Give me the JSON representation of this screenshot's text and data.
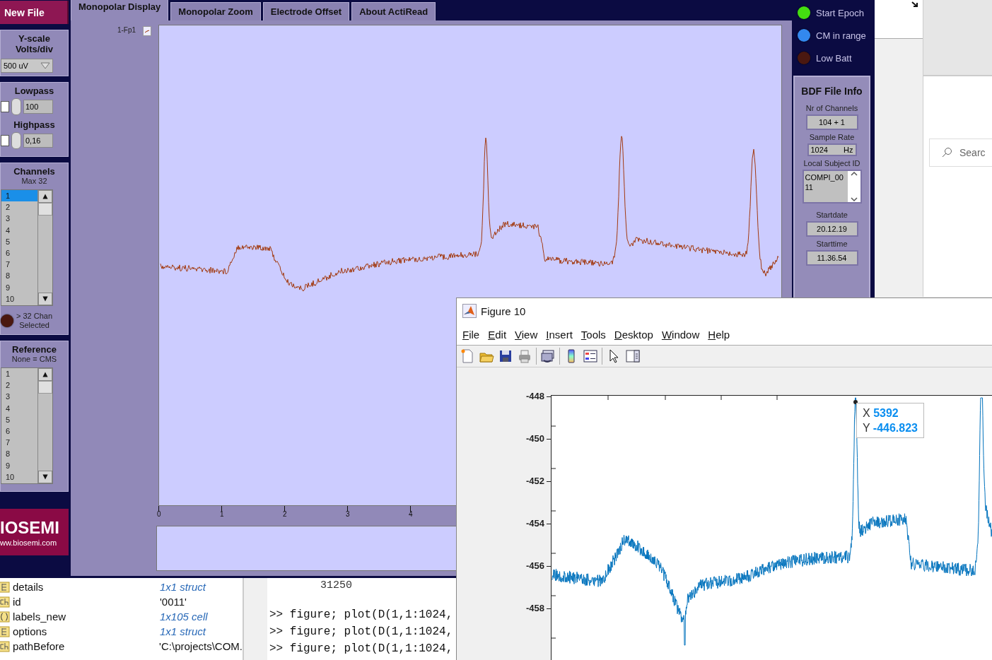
{
  "actiread": {
    "new_file_button": "New File",
    "yscale": {
      "title": "Y-scale",
      "subtitle": "Volts/div",
      "value": "500 uV"
    },
    "filters": [
      {
        "label": "Lowpass",
        "checked": false,
        "value": "100"
      },
      {
        "label": "Highpass",
        "checked": false,
        "value": "0,16"
      }
    ],
    "channels": {
      "title": "Channels",
      "subtitle": "Max 32",
      "items": [
        {
          "label": "1",
          "selected": true
        },
        {
          "label": "2",
          "selected": false
        },
        {
          "label": "3",
          "selected": false
        },
        {
          "label": "4",
          "selected": false
        },
        {
          "label": "5",
          "selected": false
        },
        {
          "label": "6",
          "selected": false
        },
        {
          "label": "7",
          "selected": false
        },
        {
          "label": "8",
          "selected": false
        },
        {
          "label": "9",
          "selected": false
        },
        {
          "label": "10",
          "selected": false
        }
      ],
      "warning_line_1": "> 32 Chan",
      "warning_line_2": "Selected"
    },
    "reference": {
      "title": "Reference",
      "subtitle": "None = CMS",
      "items": [
        {
          "label": "1",
          "selected": false
        },
        {
          "label": "2",
          "selected": false
        },
        {
          "label": "3",
          "selected": false
        },
        {
          "label": "4",
          "selected": false
        },
        {
          "label": "5",
          "selected": false
        },
        {
          "label": "6",
          "selected": false
        },
        {
          "label": "7",
          "selected": false
        },
        {
          "label": "8",
          "selected": false
        },
        {
          "label": "9",
          "selected": false
        },
        {
          "label": "10",
          "selected": false
        }
      ]
    },
    "logo": {
      "name": "IOSEMI",
      "url": "ww.biosemi.com"
    },
    "tabs": [
      {
        "label": "Monopolar Display",
        "selected": true
      },
      {
        "label": "Monopolar Zoom",
        "selected": false
      },
      {
        "label": "Electrode Offset",
        "selected": false
      },
      {
        "label": "About ActiRead",
        "selected": false
      }
    ],
    "trace_label": "1-Fp1",
    "x_ticks": [
      "0",
      "1",
      "2",
      "3",
      "4"
    ],
    "indicators": [
      {
        "label": "Start Epoch",
        "color": "#44dd11"
      },
      {
        "label": "CM in range",
        "color": "#3388ee"
      },
      {
        "label": "Low Batt",
        "color": "#4a1810"
      }
    ],
    "file_info": {
      "title": "BDF File Info",
      "channels_label": "Nr of Channels",
      "channels": "104 + 1",
      "rate_label": "Sample Rate",
      "rate": "1024",
      "rate_unit": "Hz",
      "subject_label": "Local Subject ID",
      "subject": "COMPI_0011",
      "date_label": "Startdate",
      "date": "20.12.19",
      "time_label": "Starttime",
      "time": "11.36.54"
    }
  },
  "background_window": {
    "search_placeholder": "Searc"
  },
  "workspace": {
    "rows": [
      {
        "kind": "struct",
        "name": "details",
        "value": "1x1 struct"
      },
      {
        "kind": "char",
        "name": "id",
        "value": "'0011'"
      },
      {
        "kind": "cell",
        "name": "labels_new",
        "value": "1x105 cell"
      },
      {
        "kind": "struct",
        "name": "options",
        "value": "1x1 struct"
      },
      {
        "kind": "char",
        "name": "pathBefore",
        "value": "'C:\\projects\\COM."
      }
    ]
  },
  "command_window": {
    "output": "31250",
    "lines": [
      ">> figure; plot(D(1,1:1024,",
      ">> figure; plot(D(1,1:1024,",
      ">> figure; plot(D(1,1:1024,"
    ]
  },
  "figure": {
    "title": "Figure 10",
    "menu": [
      "File",
      "Edit",
      "View",
      "Insert",
      "Tools",
      "Desktop",
      "Window",
      "Help"
    ],
    "y_ticks": [
      "-448",
      "-450",
      "-452",
      "-454",
      "-456",
      "-458"
    ],
    "datatip": {
      "x_label": "X",
      "x_value": "5392",
      "y_label": "Y",
      "y_value": "-446.823"
    }
  }
}
